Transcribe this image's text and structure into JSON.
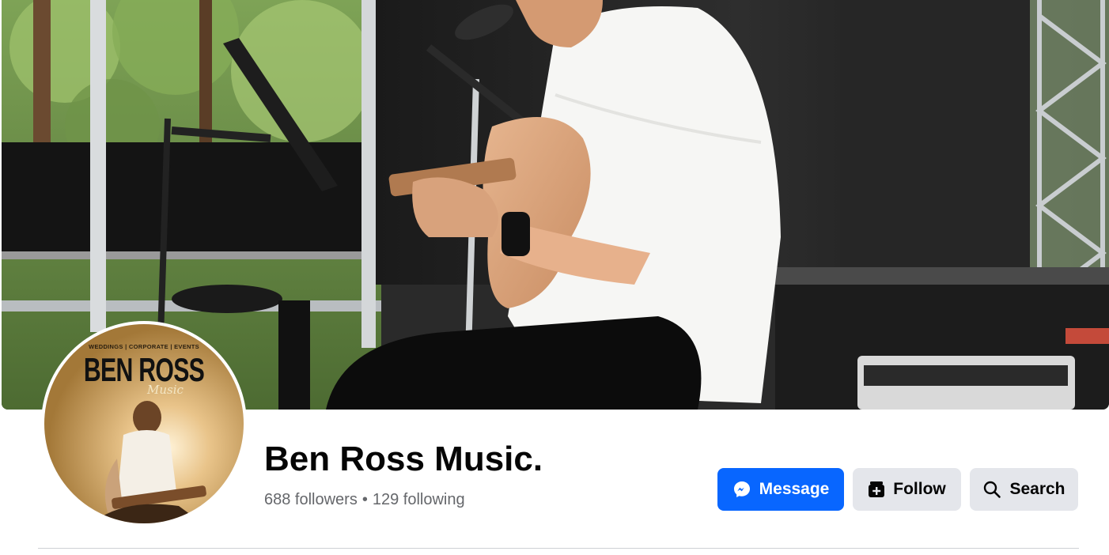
{
  "profile": {
    "name": "Ben Ross Music.",
    "followers": "688 followers",
    "separator": "•",
    "following": "129 following"
  },
  "avatar_logo": {
    "tagline": "WEDDINGS | CORPORATE | EVENTS",
    "name": "BEN ROSS",
    "script": "Music"
  },
  "actions": {
    "message_label": "Message",
    "follow_label": "Follow",
    "search_label": "Search"
  },
  "colors": {
    "primary_button": "#0866ff",
    "secondary_button": "#e4e6eb",
    "text_primary": "#050505",
    "text_secondary": "#65676b"
  },
  "icons": {
    "message": "messenger-icon",
    "follow": "follow-icon",
    "search": "search-icon"
  }
}
